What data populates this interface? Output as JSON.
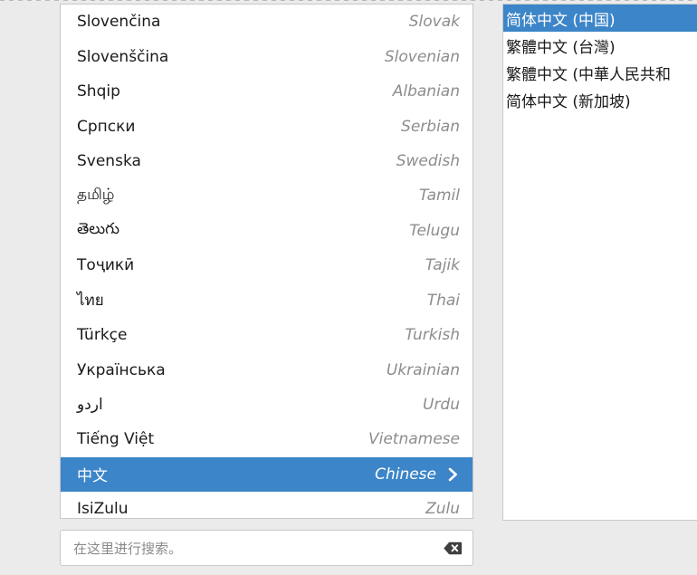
{
  "window": {
    "background_color": "#ebebeb",
    "accent_color": "#3c85c8"
  },
  "language_list": {
    "name": "language-selection-list",
    "items": [
      {
        "native": "Slovenčina",
        "english": "Slovak",
        "selected": false,
        "has_submenu": false
      },
      {
        "native": "Slovenščina",
        "english": "Slovenian",
        "selected": false,
        "has_submenu": false
      },
      {
        "native": "Shqip",
        "english": "Albanian",
        "selected": false,
        "has_submenu": false
      },
      {
        "native": "Српски",
        "english": "Serbian",
        "selected": false,
        "has_submenu": false
      },
      {
        "native": "Svenska",
        "english": "Swedish",
        "selected": false,
        "has_submenu": false
      },
      {
        "native": "தமிழ்",
        "english": "Tamil",
        "selected": false,
        "has_submenu": false
      },
      {
        "native": "తెలుగు",
        "english": "Telugu",
        "selected": false,
        "has_submenu": false
      },
      {
        "native": "Тоҷикӣ",
        "english": "Tajik",
        "selected": false,
        "has_submenu": false
      },
      {
        "native": "ไทย",
        "english": "Thai",
        "selected": false,
        "has_submenu": false
      },
      {
        "native": "Türkçe",
        "english": "Turkish",
        "selected": false,
        "has_submenu": false
      },
      {
        "native": "Українська",
        "english": "Ukrainian",
        "selected": false,
        "has_submenu": false
      },
      {
        "native": "اردو",
        "english": "Urdu",
        "selected": false,
        "has_submenu": false
      },
      {
        "native": "Tiếng Việt",
        "english": "Vietnamese",
        "selected": false,
        "has_submenu": false
      },
      {
        "native": "中文",
        "english": "Chinese",
        "selected": true,
        "has_submenu": true
      },
      {
        "native": "IsiZulu",
        "english": "Zulu",
        "selected": false,
        "has_submenu": false
      }
    ]
  },
  "variant_list": {
    "name": "chinese-variant-list",
    "items": [
      {
        "label": "简体中文 (中国)",
        "selected": true
      },
      {
        "label": "繁體中文 (台灣)",
        "selected": false
      },
      {
        "label": "繁體中文 (中華人民共和",
        "selected": false
      },
      {
        "label": "简体中文 (新加坡)",
        "selected": false
      }
    ]
  },
  "search": {
    "placeholder": "在这里进行搜索。",
    "value": "",
    "clear_icon": "backspace-clear-icon"
  }
}
